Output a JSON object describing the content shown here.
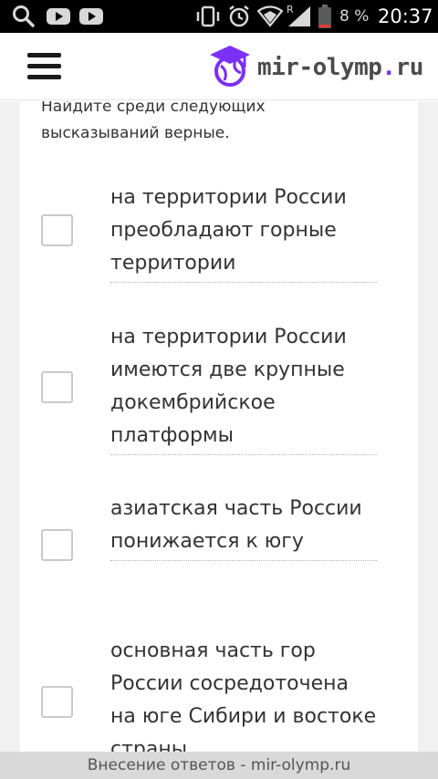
{
  "status_bar": {
    "battery_percent": "8 %",
    "time": "20:37",
    "signal_indicator": "R",
    "icons": [
      "search-icon",
      "youtube-icon",
      "youtube-icon",
      "vibrate-icon",
      "alarm-icon",
      "wifi-icon",
      "signal-icon",
      "battery-icon"
    ]
  },
  "header": {
    "menu_icon": "hamburger-menu-icon",
    "logo_text_main": "mir-olymp",
    "logo_text_dot": ".",
    "logo_text_tld": "ru",
    "logo_color": "#7b2ff7"
  },
  "question": {
    "text": "Найдите среди следующих высказываний верные."
  },
  "options": [
    {
      "label": "на территории России преобладают горные территории",
      "checked": false
    },
    {
      "label": "на территории России имеются две крупные докембрийское платформы",
      "checked": false
    },
    {
      "label": "азиатская часть России понижается к югу",
      "checked": false
    },
    {
      "label": "основная часть гор России сосредоточена на юге Сибири и востоке страны",
      "checked": false
    }
  ],
  "footer": {
    "text": "Внесение ответов - mir-olymp.ru"
  }
}
